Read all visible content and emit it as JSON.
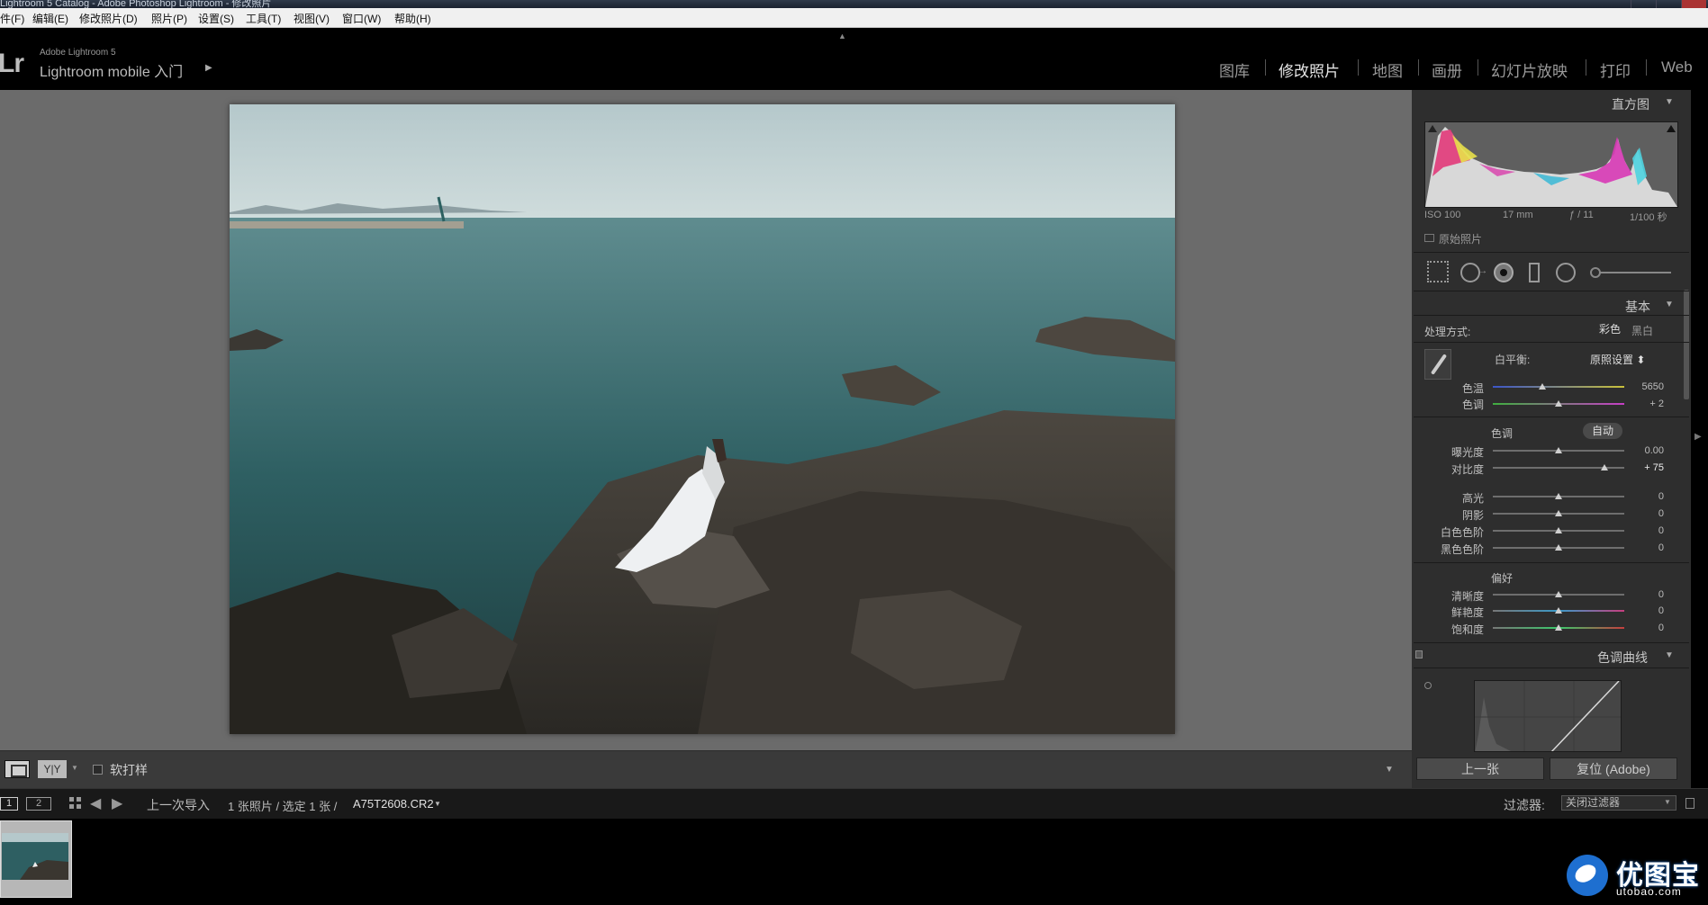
{
  "window": {
    "title": "Lightroom 5 Catalog - Adobe Photoshop Lightroom - 修改照片"
  },
  "menu": [
    "文件(F)",
    "编辑(E)",
    "修改照片(D)",
    "照片(P)",
    "设置(S)",
    "工具(T)",
    "视图(V)",
    "窗口(W)",
    "帮助(H)"
  ],
  "identity": {
    "logo": "Lr",
    "app": "Adobe Lightroom 5",
    "mobile": "Lightroom mobile 入门",
    "arrow": "▶"
  },
  "modules": [
    "图库",
    "修改照片",
    "地图",
    "画册",
    "幻灯片放映",
    "打印",
    "Web"
  ],
  "toolbar": {
    "yy_label": "Y|Y",
    "softproof_label": "软打样"
  },
  "histogram": {
    "title": "直方图",
    "iso": "ISO 100",
    "focal": "17 mm",
    "aperture": "ƒ / 11",
    "shutter": "1/100 秒",
    "original_label": "原始照片"
  },
  "basic": {
    "title": "基本",
    "treatment_label": "处理方式:",
    "color_label": "彩色",
    "bw_label": "黑白",
    "wb_label": "白平衡:",
    "wb_value": "原照设置 ⬍",
    "temp_label": "色温",
    "temp_value": "5650",
    "temp_pos": 0.38,
    "tint_label": "色调",
    "tint_value": "+ 2",
    "tint_pos": 0.5,
    "tone_label": "色调",
    "auto_label": "自动",
    "exposure_label": "曝光度",
    "exposure_value": "0.00",
    "exposure_pos": 0.5,
    "contrast_label": "对比度",
    "contrast_value": "+ 75",
    "contrast_pos": 0.85,
    "highlights_label": "高光",
    "highlights_value": "0",
    "shadows_label": "阴影",
    "shadows_value": "0",
    "whites_label": "白色色阶",
    "whites_value": "0",
    "blacks_label": "黑色色阶",
    "blacks_value": "0",
    "presence_label": "偏好",
    "clarity_label": "清晰度",
    "clarity_value": "0",
    "vibrance_label": "鲜艳度",
    "vibrance_value": "0",
    "saturation_label": "饱和度",
    "saturation_value": "0"
  },
  "tonecurve": {
    "title": "色调曲线"
  },
  "buttons": {
    "prev": "上一张",
    "reset": "复位 (Adobe)"
  },
  "filmbar": {
    "view1": "1",
    "view2": "2",
    "source": "上一次导入",
    "count": "1 张照片 / 选定 1 张 /",
    "filename": "A75T2608.CR2",
    "filter_label": "过滤器:",
    "filter_value": "关闭过滤器"
  },
  "watermark": {
    "name": "优图宝",
    "url": "utobao.com"
  }
}
